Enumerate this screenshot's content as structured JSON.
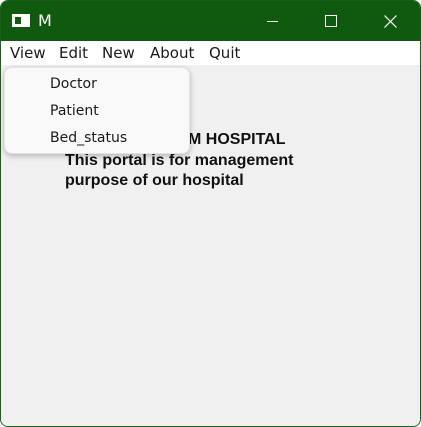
{
  "window": {
    "title": "M",
    "accent_color": "#0f5a0f"
  },
  "title_controls": {
    "minimize_icon": "minimize-icon",
    "maximize_icon": "maximize-icon",
    "close_icon": "close-icon"
  },
  "menubar": {
    "items": [
      {
        "label": "View"
      },
      {
        "label": "Edit"
      },
      {
        "label": "New"
      },
      {
        "label": "About"
      },
      {
        "label": "Quit"
      }
    ]
  },
  "view_menu": {
    "items": [
      {
        "label": "Doctor"
      },
      {
        "label": "Patient"
      },
      {
        "label": "Bed_status"
      }
    ]
  },
  "content": {
    "line1": "M HOSPITAL",
    "line2": "This portal is for management",
    "line3": "purpose of our hospital"
  }
}
